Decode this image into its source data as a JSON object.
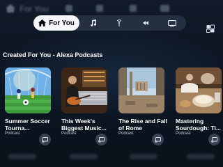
{
  "ghost_bar": {
    "label": "For You"
  },
  "nav": {
    "tabs": [
      {
        "label": "For You",
        "icon": "home-icon",
        "active": true
      },
      {
        "label": "",
        "icon": "music-icon"
      },
      {
        "label": "",
        "icon": "radio-icon"
      },
      {
        "label": "",
        "icon": "skip-icon"
      },
      {
        "label": "",
        "icon": "tv-icon"
      }
    ],
    "settings_icon": "settings-icon"
  },
  "section": {
    "title": "Created For You - Alexa Podcasts"
  },
  "cards": [
    {
      "title": "Summer Soccer Tourna...",
      "subtitle": "Podcast",
      "icon": "cast-icon"
    },
    {
      "title": "This Week's Biggest Music...",
      "subtitle": "Podcast",
      "icon": "cast-icon"
    },
    {
      "title": "The Rise and Fall of Rome",
      "subtitle": "Podcast",
      "icon": "cast-icon"
    },
    {
      "title": "Mastering Sourdough: Ti...",
      "subtitle": "Podcast",
      "icon": "cast-icon"
    }
  ],
  "colors": {
    "background": "#0d1624",
    "pill": "#283446",
    "active_tab": "#f4f6f9"
  }
}
